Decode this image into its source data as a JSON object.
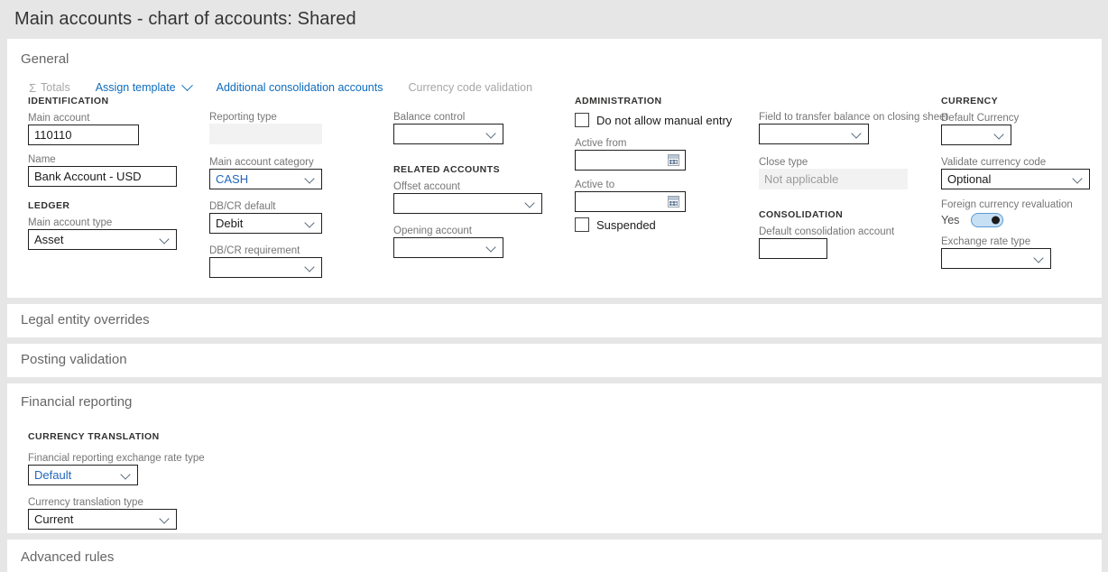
{
  "page": {
    "title": "Main accounts - chart of accounts: Shared"
  },
  "commandbar": [
    {
      "label": "Totals",
      "icon": "sigma-icon",
      "state": "disabled",
      "caret": false
    },
    {
      "label": "Assign template",
      "icon": "",
      "state": "link",
      "caret": true
    },
    {
      "label": "Additional consolidation accounts",
      "icon": "",
      "state": "link",
      "caret": false
    },
    {
      "label": "Currency code validation",
      "icon": "",
      "state": "disabled",
      "caret": false
    }
  ],
  "sections": {
    "general": "General",
    "legal_entity_overrides": "Legal entity overrides",
    "posting_validation": "Posting validation",
    "financial_reporting": "Financial reporting",
    "advanced_rules": "Advanced rules"
  },
  "general": {
    "col1": {
      "group_identification": "IDENTIFICATION",
      "main_account_label": "Main account",
      "main_account_value": "110110",
      "name_label": "Name",
      "name_value": "Bank Account - USD",
      "group_ledger": "LEDGER",
      "main_account_type_label": "Main account type",
      "main_account_type_value": "Asset"
    },
    "col2": {
      "reporting_type_label": "Reporting type",
      "reporting_type_value": "",
      "main_account_category_label": "Main account category",
      "main_account_category_value": "CASH",
      "dbcr_default_label": "DB/CR default",
      "dbcr_default_value": "Debit",
      "dbcr_requirement_label": "DB/CR requirement",
      "dbcr_requirement_value": ""
    },
    "col3": {
      "balance_control_label": "Balance control",
      "balance_control_value": "",
      "group_related_accounts": "RELATED ACCOUNTS",
      "offset_account_label": "Offset account",
      "offset_account_value": "",
      "opening_account_label": "Opening account",
      "opening_account_value": ""
    },
    "col4": {
      "group_administration": "ADMINISTRATION",
      "no_manual_entry_label": "Do not allow manual entry",
      "no_manual_entry_checked": false,
      "active_from_label": "Active from",
      "active_from_value": "",
      "active_to_label": "Active to",
      "active_to_value": "",
      "suspended_label": "Suspended",
      "suspended_checked": false
    },
    "col5": {
      "transfer_balance_label": "Field to transfer balance on closing sheet",
      "transfer_balance_value": "",
      "close_type_label": "Close type",
      "close_type_value": "Not applicable",
      "group_consolidation": "CONSOLIDATION",
      "default_consolidation_label": "Default consolidation account",
      "default_consolidation_value": ""
    },
    "col6": {
      "group_currency": "CURRENCY",
      "default_currency_label": "Default Currency",
      "default_currency_value": "",
      "validate_currency_label": "Validate currency code",
      "validate_currency_value": "Optional",
      "fx_revaluation_label": "Foreign currency revaluation",
      "fx_revaluation_state": "Yes",
      "exchange_rate_type_label": "Exchange rate type",
      "exchange_rate_type_value": ""
    }
  },
  "financial_reporting": {
    "group_currency_translation": "CURRENCY TRANSLATION",
    "fr_exchange_rate_type_label": "Financial reporting exchange rate type",
    "fr_exchange_rate_type_value": "Default",
    "currency_translation_type_label": "Currency translation type",
    "currency_translation_type_value": "Current"
  },
  "colors": {
    "accent_link": "#0f6cbd",
    "page_background": "#e6e6e6",
    "card_background": "#ffffff",
    "toggle_on": "#c7e0f4",
    "value_blue": "#2266bb"
  }
}
